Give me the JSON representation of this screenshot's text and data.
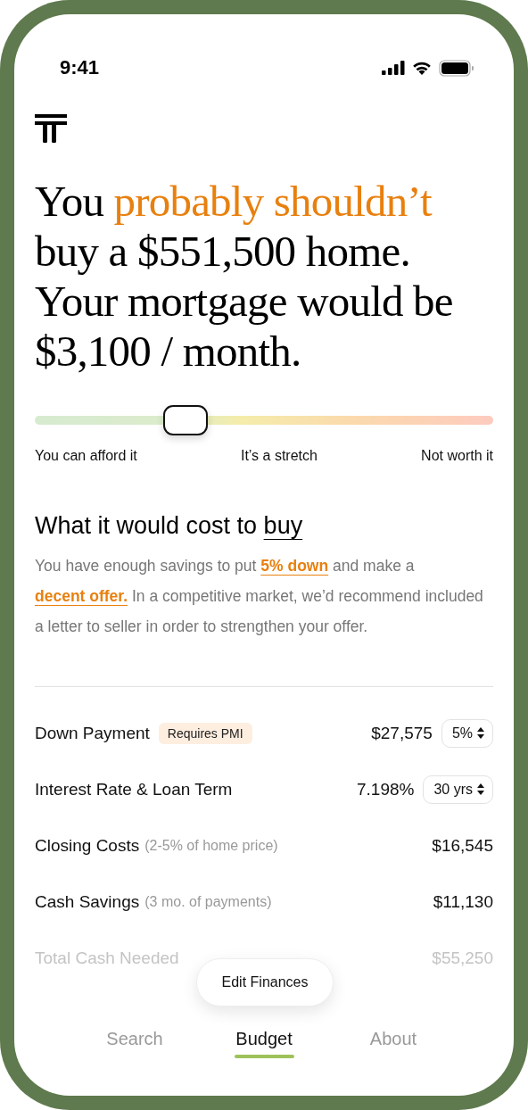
{
  "status_bar": {
    "time": "9:41"
  },
  "headline": [
    {
      "text": "You ",
      "highlight": false
    },
    {
      "text": "probably shouldn’t",
      "highlight": true
    },
    {
      "text": " buy a $551,500 home. Your mortgage would be $3,100 / month.",
      "highlight": false
    }
  ],
  "affordability": {
    "level": 0.33,
    "labels": [
      "You can afford it",
      "It’s a stretch",
      "Not worth it"
    ]
  },
  "section": {
    "title": "What it would cost to ",
    "title_link": "buy",
    "paragraph": [
      {
        "kind": "text",
        "text": "You have enough savings to put "
      },
      {
        "kind": "link",
        "text": "5% down"
      },
      {
        "kind": "text",
        "text": " and make a "
      },
      {
        "kind": "link",
        "text": "decent offer."
      },
      {
        "kind": "text",
        "text": " In a competitive market, we’d recommend included a letter to seller in order to strengthen your offer."
      }
    ]
  },
  "rows": [
    {
      "label": "Down Payment",
      "badge": "Requires PMI",
      "value": "$27,575",
      "select": "5%",
      "muted": false
    },
    {
      "label": "Interest Rate & Loan Term",
      "value": "7.198%",
      "select": "30 yrs",
      "muted": false
    },
    {
      "label": "Closing Costs",
      "note": "(2-5% of home price)",
      "value": "$16,545",
      "muted": false
    },
    {
      "label": "Cash Savings",
      "note": "(3 mo. of payments)",
      "value": "$11,130",
      "muted": false
    },
    {
      "label": "Total Cash Needed",
      "value": "$55,250",
      "muted": true
    }
  ],
  "floating_button": "Edit Finances",
  "tabs": [
    {
      "label": "Search",
      "selected": false
    },
    {
      "label": "Budget",
      "selected": true
    },
    {
      "label": "About",
      "selected": false
    }
  ]
}
